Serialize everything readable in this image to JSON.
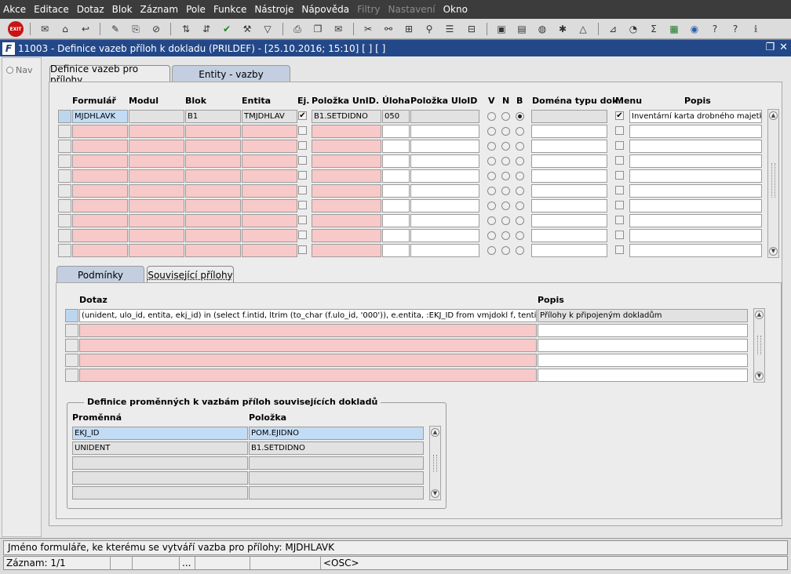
{
  "menu": [
    "Akce",
    "Editace",
    "Dotaz",
    "Blok",
    "Záznam",
    "Pole",
    "Funkce",
    "Nástroje",
    "Nápověda",
    "Filtry",
    "Nastavení",
    "Okno"
  ],
  "toolbar": {
    "exit_label": "EXIT"
  },
  "window": {
    "title": "11003 - Definice vazeb příloh k dokladu (PRILDEF) - [25.10.2016; 15:10]  [ ]  [ ]"
  },
  "nav": {
    "label": "Nav"
  },
  "tabs_top": [
    "Definice vazeb pro přílohy",
    "Entity - vazby"
  ],
  "grid1": {
    "headers": [
      "Formulář",
      "Modul",
      "Blok",
      "Entita",
      "Ej.",
      "Položka UnID.",
      "Úloha",
      "Položka UloID",
      "V",
      "N",
      "B",
      "Doména typu dok.",
      "Menu",
      "Popis"
    ],
    "row1": {
      "formular": "MJDHLAVK",
      "modul": "",
      "blok": "B1",
      "entita": "TMJDHLAV",
      "ej": "✔",
      "polozka_unid": "B1.SETDIDNO",
      "uloha": "050",
      "polozka_uloid": "",
      "radio": "B",
      "domena": "",
      "menu": "✔",
      "popis": "Inventární karta drobného majetku"
    }
  },
  "tabs_bottom": [
    "Podmínky",
    "Související přílohy"
  ],
  "grid2": {
    "headers": [
      "Dotaz",
      "Popis"
    ],
    "row1": {
      "dotaz": "(unident, ulo_id, entita, ekj_id) in (select f.intid, ltrim (to_char (f.ulo_id, '000')), e.entita, :EKJ_ID from vmjdokl f, tentity e wh",
      "popis": "Přílohy k připojeným dokladům"
    }
  },
  "group": {
    "title": "Definice proměnných k vazbám příloh souvisejících dokladů",
    "headers": [
      "Proměnná",
      "Položka"
    ],
    "rows": [
      {
        "promenna": "EKJ_ID",
        "polozka": "POM.EJIDNO"
      },
      {
        "promenna": "UNIDENT",
        "polozka": "B1.SETDIDNO"
      }
    ]
  },
  "status": {
    "hint": "Jméno formuláře, ke kterému se vytváří vazba pro přílohy: MJDHLAVK",
    "record": "Záznam: 1/1",
    "dots": "...",
    "osc": "<OSC>"
  }
}
